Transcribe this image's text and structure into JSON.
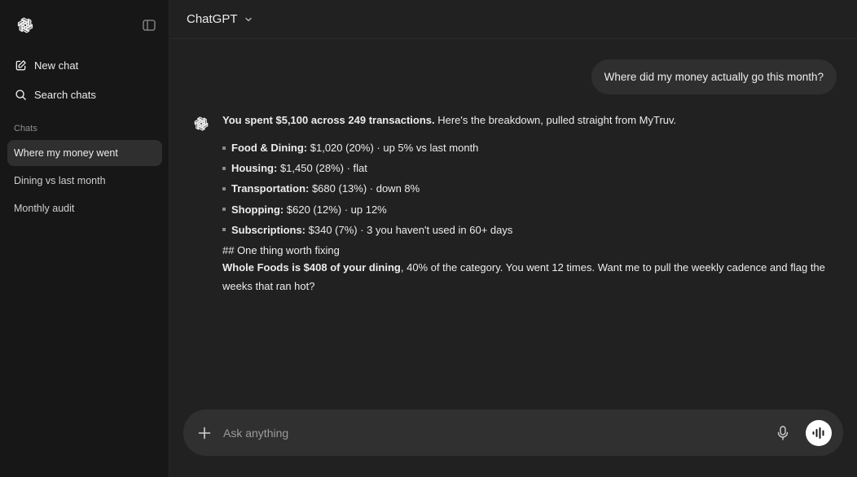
{
  "sidebar": {
    "actions": [
      {
        "label": "New chat",
        "icon": "new-chat-icon"
      },
      {
        "label": "Search chats",
        "icon": "search-icon"
      }
    ],
    "section_label": "Chats",
    "chats": [
      {
        "label": "Where my money went",
        "active": true
      },
      {
        "label": "Dining vs last month",
        "active": false
      },
      {
        "label": "Monthly audit",
        "active": false
      }
    ]
  },
  "header": {
    "model_label": "ChatGPT"
  },
  "conversation": {
    "user_message": "Where did my money actually go this month?",
    "assistant": {
      "intro_bold": "You spent $5,100 across 249 transactions.",
      "intro_rest": " Here's the breakdown, pulled straight from MyTruv.",
      "bullets": [
        {
          "label": "Food & Dining:",
          "text": " $1,020 (20%) · up 5% vs last month"
        },
        {
          "label": "Housing:",
          "text": " $1,450 (28%) · flat"
        },
        {
          "label": "Transportation:",
          "text": " $680 (13%) · down 8%"
        },
        {
          "label": "Shopping:",
          "text": " $620 (12%) · up 12%"
        },
        {
          "label": "Subscriptions:",
          "text": " $340 (7%) · 3 you haven't used in 60+ days"
        }
      ],
      "heading": "## One thing worth fixing",
      "closing_bold": "Whole Foods is $408 of your dining",
      "closing_rest": ", 40% of the category. You went 12 times. Want me to pull the weekly cadence and flag the weeks that ran hot?"
    }
  },
  "composer": {
    "placeholder": "Ask anything"
  },
  "colors": {
    "background": "#212121",
    "sidebar": "#171717",
    "bubble": "#2f2f2f",
    "composer": "#303030",
    "text": "#ececec"
  }
}
